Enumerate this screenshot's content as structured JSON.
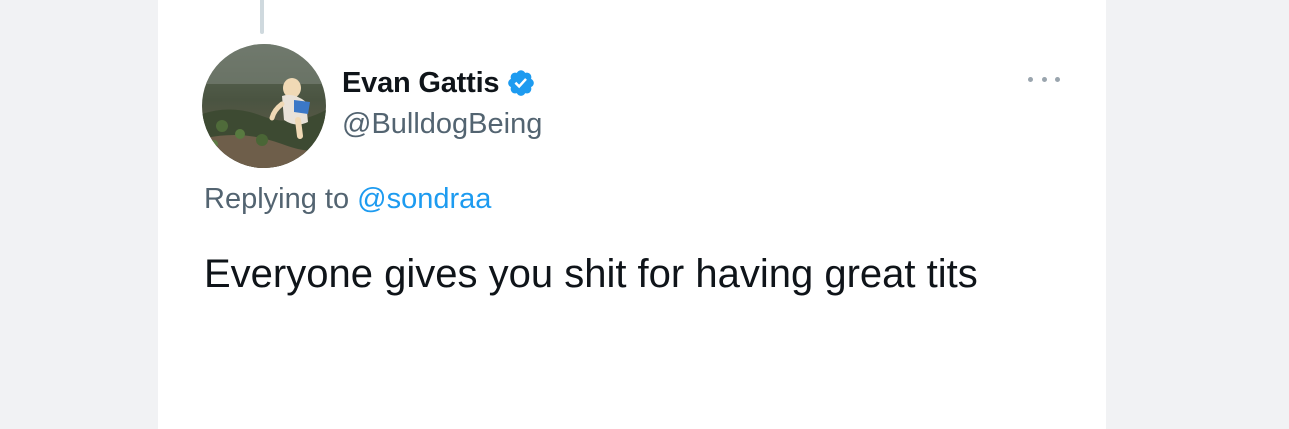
{
  "author": {
    "display_name": "Evan Gattis",
    "handle": "@BulldogBeing",
    "verified": true
  },
  "reply": {
    "prefix": "Replying to",
    "mention": "@sondraa"
  },
  "tweet": {
    "text": "Everyone gives you shit for having great tits"
  },
  "icons": {
    "verified": "verified-badge-icon",
    "more": "more-options-icon"
  },
  "colors": {
    "accent": "#1d9bf0",
    "text_primary": "#0f1419",
    "text_secondary": "#536471"
  }
}
